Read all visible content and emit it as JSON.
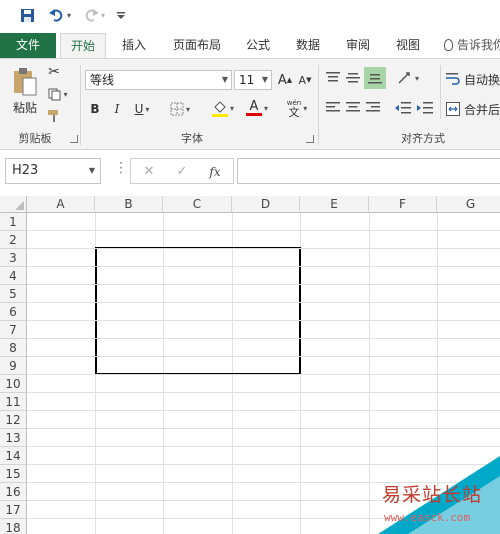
{
  "quick_access": {
    "save_icon": "save-icon",
    "undo_icon": "undo-icon",
    "redo_icon": "redo-icon",
    "customize_icon": "customize-icon"
  },
  "tabs": {
    "file": "文件",
    "home": "开始",
    "insert": "插入",
    "page_layout": "页面布局",
    "formulas": "公式",
    "data": "数据",
    "review": "审阅",
    "view": "视图",
    "tell_me": "告诉我你"
  },
  "ribbon": {
    "clipboard": {
      "paste_label": "粘贴",
      "group_label": "剪贴板"
    },
    "font": {
      "font_name": "等线",
      "font_size": "11",
      "bold": "B",
      "italic": "I",
      "underline": "U",
      "grow": "A",
      "shrink": "A",
      "wen": "wén",
      "wen_char": "文",
      "font_color": "A",
      "group_label": "字体"
    },
    "alignment": {
      "wrap_text": "自动换",
      "merge": "合并后",
      "group_label": "对齐方式"
    }
  },
  "formula_bar": {
    "name_box": "H23",
    "cancel": "✕",
    "enter": "✓",
    "fx": "fx",
    "value": ""
  },
  "sheet": {
    "columns": [
      "A",
      "B",
      "C",
      "D",
      "E",
      "F",
      "G"
    ],
    "rows": [
      "1",
      "2",
      "3",
      "4",
      "5",
      "6",
      "7",
      "8",
      "9",
      "10",
      "11",
      "12",
      "13",
      "14",
      "15",
      "16",
      "17",
      "18"
    ]
  },
  "watermark": {
    "text": "易采站长站",
    "url": "www.easck.com"
  },
  "colors": {
    "excel_green": "#217346",
    "ribbon_bg": "#f3f3f3",
    "grid_line": "#e1e1e1"
  }
}
